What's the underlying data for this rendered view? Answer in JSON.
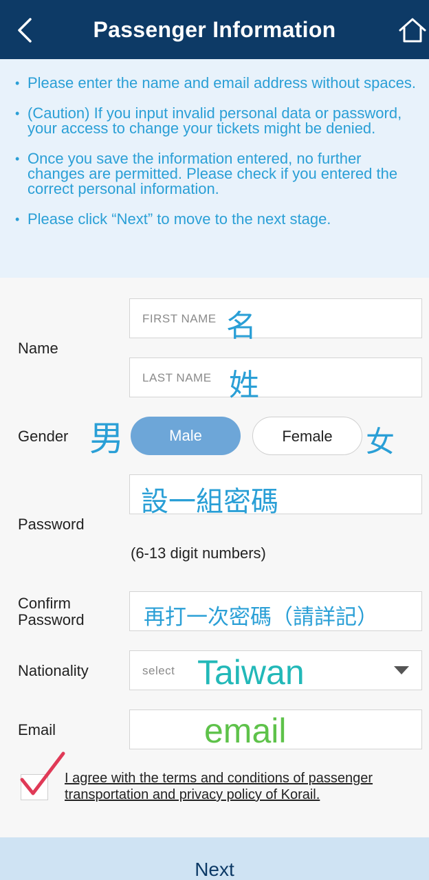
{
  "header": {
    "title": "Passenger Information",
    "back_icon": "chevron-left-icon",
    "home_icon": "home-icon"
  },
  "notices": [
    "Please enter the name and email address without spaces.",
    "(Caution) If you input invalid personal data or password, your access to change your tickets might be denied.",
    "Once you save the information entered, no further changes are permitted. Please check if you entered the correct personal information.",
    "Please click “Next” to move to the next stage."
  ],
  "form": {
    "name_label": "Name",
    "first_name_placeholder": "FIRST NAME",
    "last_name_placeholder": "LAST NAME",
    "gender_label": "Gender",
    "male_label": "Male",
    "female_label": "Female",
    "password_label": "Password",
    "password_hint": "(6-13 digit numbers)",
    "confirm_label_line1": "Confirm",
    "confirm_label_line2": "Password",
    "nationality_label": "Nationality",
    "nationality_placeholder": "select",
    "email_label": "Email",
    "agree_text": "I agree with the terms and conditions of passenger transportation and privacy policy of Korail."
  },
  "annotations": {
    "first_name": "名",
    "last_name": "姓",
    "male": "男",
    "female": "女",
    "password": "設一組密碼",
    "confirm": "再打一次密碼（請詳記）",
    "nationality": "Taiwan",
    "email": "email"
  },
  "footer": {
    "next_label": "Next"
  },
  "colors": {
    "header_bg": "#0d3a66",
    "notice_bg": "#e8f2fb",
    "notice_text": "#2a9fd6",
    "male_selected": "#6da6d8",
    "annotation_blue": "#2a9fd6",
    "annotation_teal": "#22b8b8",
    "annotation_green": "#5ec24a",
    "checkmark": "#e03a57",
    "next_bg": "#cfe3f3"
  }
}
